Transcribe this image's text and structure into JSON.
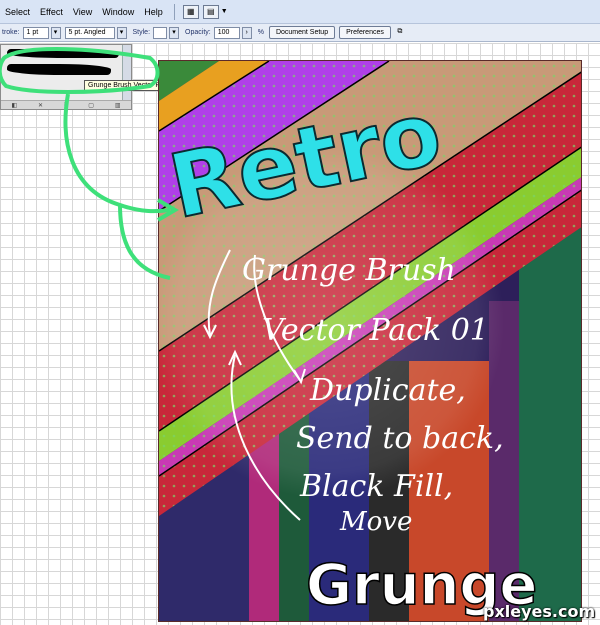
{
  "menu": {
    "items": [
      "Select",
      "Effect",
      "View",
      "Window",
      "Help"
    ]
  },
  "control_bar": {
    "stroke_label": "troke:",
    "stroke_value": "1 pt",
    "brush_value": "5 pt. Angled",
    "style_label": "Style:",
    "opacity_label": "Opacity:",
    "opacity_value": "100",
    "opacity_unit": "%",
    "document_setup": "Document Setup",
    "preferences": "Preferences"
  },
  "brush_panel": {
    "tooltip": "Grunge Brush Vector Pack 01"
  },
  "artwork": {
    "title": "Retro",
    "footer": "Grunge",
    "notes": [
      "Grunge Brush",
      "Vector Pack 01",
      "Duplicate,",
      "Send to back,",
      "Black Fill,",
      "Move"
    ],
    "colors": {
      "purple": "#b040e8",
      "tan": "#c89a78",
      "red": "#c8283a",
      "lime": "#8acc30",
      "magenta": "#c83ab4",
      "green": "#1e7a3c",
      "cyan": "#2ee0e8",
      "highlight": "#3ee07a"
    }
  },
  "watermark": "pxleyes.com"
}
